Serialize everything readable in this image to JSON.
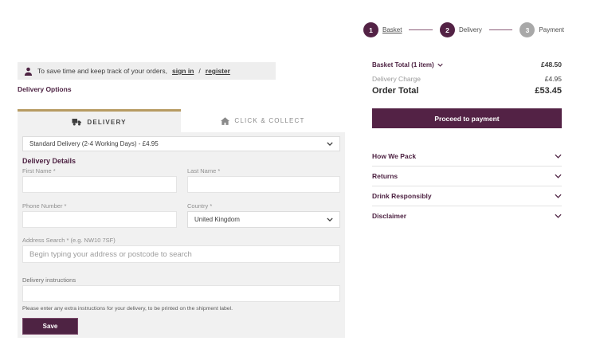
{
  "colors": {
    "brand_maroon": "#4e2343",
    "button_maroon": "#532245",
    "tab_gold": "#b79b62",
    "panel_grey": "#f1f1f1",
    "pending_step_grey": "#a8a8a8"
  },
  "progress": {
    "steps": [
      {
        "number": "1",
        "label": "Basket"
      },
      {
        "number": "2",
        "label": "Delivery"
      },
      {
        "number": "3",
        "label": "Payment"
      }
    ]
  },
  "signin_banner": {
    "text": "To save time and keep track of your orders,",
    "sign_in_link": "sign in",
    "separator": "/",
    "register_link": "register"
  },
  "page": {
    "section_title": "Delivery Options"
  },
  "tabs": {
    "delivery_label": "DELIVERY",
    "click_collect_label": "CLICK & COLLECT"
  },
  "form": {
    "shipping_method_value": "Standard Delivery (2-4 Working Days) - £4.95",
    "details_title": "Delivery Details",
    "first_name_label": "First Name *",
    "last_name_label": "Last Name *",
    "phone_label": "Phone Number *",
    "country_label": "Country *",
    "country_value": "United Kingdom",
    "address_label": "Address Search * (e.g. NW10 7SF)",
    "address_placeholder": "Begin typing your address or postcode to search",
    "instructions_label": "Delivery instructions",
    "instructions_help": "Please enter any extra instructions for your delivery, to be printed on the shipment label.",
    "save_label": "Save"
  },
  "summary": {
    "basket_total_label": "Basket Total (1 item)",
    "basket_total_value": "£48.50",
    "delivery_charge_label": "Delivery Charge",
    "delivery_charge_value": "£4.95",
    "order_total_label": "Order Total",
    "order_total_value": "£53.45",
    "proceed_label": "Proceed to payment"
  },
  "accordion": {
    "items": [
      {
        "label": "How We Pack"
      },
      {
        "label": "Returns"
      },
      {
        "label": "Drink Responsibly"
      },
      {
        "label": "Disclaimer"
      }
    ]
  }
}
